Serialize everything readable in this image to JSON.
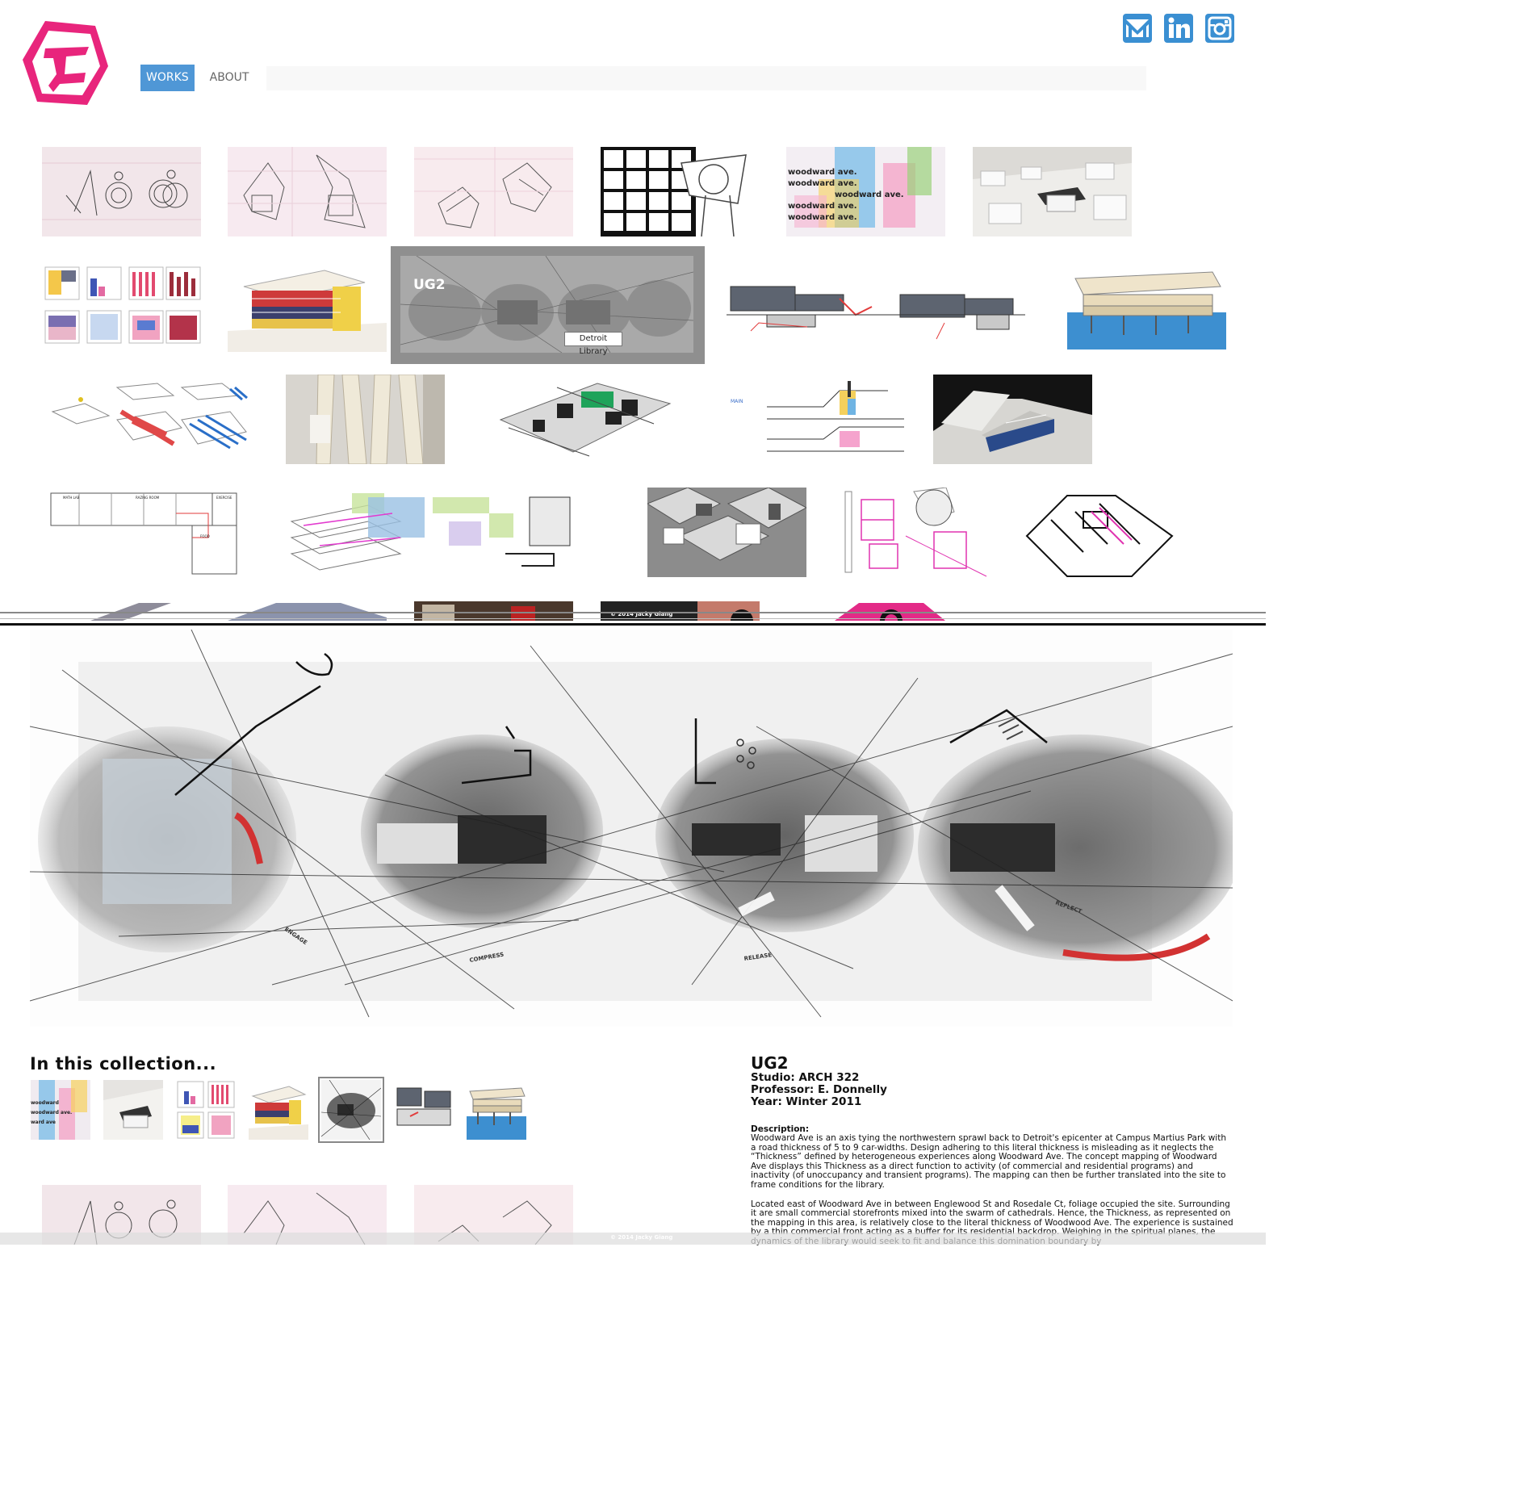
{
  "site": {
    "logo_icon": "hexagon-logo-icon",
    "brand_color": "#e8257c",
    "accent_color": "#4f97d6"
  },
  "nav": {
    "works_label": "WORKS",
    "about_label": "ABOUT"
  },
  "social": {
    "mail_icon": "mail-icon",
    "linkedin_icon": "linkedin-icon",
    "instagram_icon": "instagram-icon",
    "icon_color": "#3a8fd2"
  },
  "hover_card": {
    "title": "UG2",
    "tooltip": "Detroit Library"
  },
  "footer": {
    "copyright": "© 2014 Jacky Giang"
  },
  "collection": {
    "title": "In this collection..."
  },
  "project": {
    "title": "UG2",
    "studio": "Studio: ARCH 322",
    "professor": "Professor: E. Donnelly",
    "year": "Year: Winter 2011",
    "description_label": "Description:",
    "description_p1": "Woodward Ave is an axis tying the northwestern sprawl back to Detroit's epicenter at Campus Martius Park with a road thickness of 5 to 9 car-widths. Design adhering to this literal thickness is misleading as it neglects the “Thickness” defined by heterogeneous experiences along Woodward Ave. The concept mapping of Woodward Ave displays this Thickness as a direct function to activity (of commercial and residential programs) and inactivity (of unoccupancy and transient programs). The mapping can then be further translated into the site to frame conditions for the library.",
    "description_p2": "Located east of Woodward Ave in between Englewood St and Rosedale Ct, foliage occupied the site. Surrounding it are small commercial storefronts mixed into the swarm of cathedrals. Hence, the Thickness, as represented on the mapping in this area, is relatively close to the literal thickness of Woodwood Ave. The experience is sustained by a thin commercial front acting as a buffer for its residential backdrop. Weighing in the spiritual planes, the dynamics of the library would seek to fit and balance this domination boundary by"
  },
  "hero_labels": {
    "engage": "ENGAGE",
    "compress": "COMPRESS",
    "release": "RELEASE",
    "reflect": "REFLECT"
  },
  "woodward_text": "woodward ave."
}
